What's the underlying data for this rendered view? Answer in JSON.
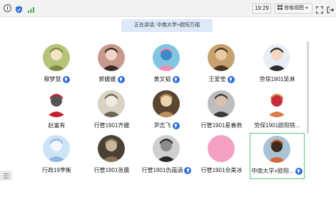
{
  "topbar": {
    "time": "19:29",
    "view_mode": "宫格视图",
    "icons": [
      "info-icon",
      "shield-icon",
      "signal-icon",
      "grid-view-icon",
      "fullscreen-icon",
      "exit-icon"
    ]
  },
  "speaker_banner": {
    "text": "正在讲话: 中南大学+欧阳万福"
  },
  "participants": [
    {
      "name": "穆梦慧",
      "mic": true,
      "avatar_colors": [
        "#b6c47a",
        "#7c8a42",
        "#f4e4c4"
      ]
    },
    {
      "name": "郭媛媛",
      "mic": true,
      "avatar_colors": [
        "#c99a8c",
        "#3a2a28",
        "#f1d3c8"
      ]
    },
    {
      "name": "黄文韬",
      "mic": true,
      "avatar_colors": [
        "#7fc7e0",
        "#f28cb7",
        "#3d8ac7"
      ]
    },
    {
      "name": "王爱莹",
      "mic": true,
      "avatar_colors": [
        "#c7a070",
        "#4a3320",
        "#e8c9a0"
      ]
    },
    {
      "name": "劳保1901吴淋",
      "mic": false,
      "avatar_colors": [
        "#e8eef5",
        "#2d2d2d",
        "#f5d7c2"
      ]
    },
    {
      "name": "赵富有",
      "mic": false,
      "avatar_colors": [
        "#ffffff",
        "#c41f2e",
        "#555555"
      ]
    },
    {
      "name": "行管1901齐媛",
      "mic": false,
      "avatar_colors": [
        "#d9d3c4",
        "#6d6356",
        "#f1ece2"
      ]
    },
    {
      "name": "尹志飞",
      "mic": true,
      "avatar_colors": [
        "#5a4630",
        "#b98d58",
        "#e9d2ad"
      ]
    },
    {
      "name": "行管1901星春燕",
      "mic": false,
      "avatar_colors": [
        "#bdbdbd",
        "#3a3a3a",
        "#d9c1b1"
      ]
    },
    {
      "name": "劳保1901欧阳铁...",
      "mic": false,
      "avatar_colors": [
        "#ffffff",
        "#d97c4c",
        "#c72c3a"
      ]
    },
    {
      "name": "行政19李衡",
      "mic": false,
      "avatar_colors": [
        "#cde4f7",
        "#8fb6e0",
        "#f3f6fb"
      ]
    },
    {
      "name": "行管1901张晨",
      "mic": false,
      "avatar_colors": [
        "#4a4034",
        "#8a7258",
        "#c9b89c"
      ]
    },
    {
      "name": "行管1901仇蕴涵",
      "mic": true,
      "avatar_colors": [
        "#cfcfcf",
        "#2a2a2a",
        "#8c8c8c"
      ]
    },
    {
      "name": "行管1901佘美冰",
      "mic": false,
      "avatar_colors": [
        "#f4a0c3",
        "#f4a0c3",
        "#f4a0c3"
      ]
    },
    {
      "name": "中南大学+欧阳...",
      "mic": true,
      "active": true,
      "avatar_colors": [
        "#a9c3d6",
        "#d06a3a",
        "#3a2a20"
      ]
    }
  ]
}
